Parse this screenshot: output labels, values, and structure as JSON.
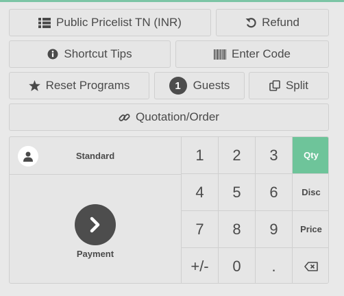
{
  "controls": {
    "pricelist": "Public Pricelist TN (INR)",
    "refund": "Refund",
    "shortcut_tips": "Shortcut Tips",
    "enter_code": "Enter Code",
    "reset_programs": "Reset Programs",
    "guests_count": "1",
    "guests": "Guests",
    "split": "Split",
    "quotation": "Quotation/Order"
  },
  "customer": {
    "label": "Standard"
  },
  "payment": {
    "label": "Payment"
  },
  "numpad": {
    "k1": "1",
    "k2": "2",
    "k3": "3",
    "k4": "4",
    "k5": "5",
    "k6": "6",
    "k7": "7",
    "k8": "8",
    "k9": "9",
    "sign": "+/-",
    "k0": "0",
    "dot": ".",
    "qty": "Qty",
    "disc": "Disc",
    "price": "Price"
  },
  "colors": {
    "accent": "#6ec49a",
    "dark": "#4d4d4d"
  }
}
